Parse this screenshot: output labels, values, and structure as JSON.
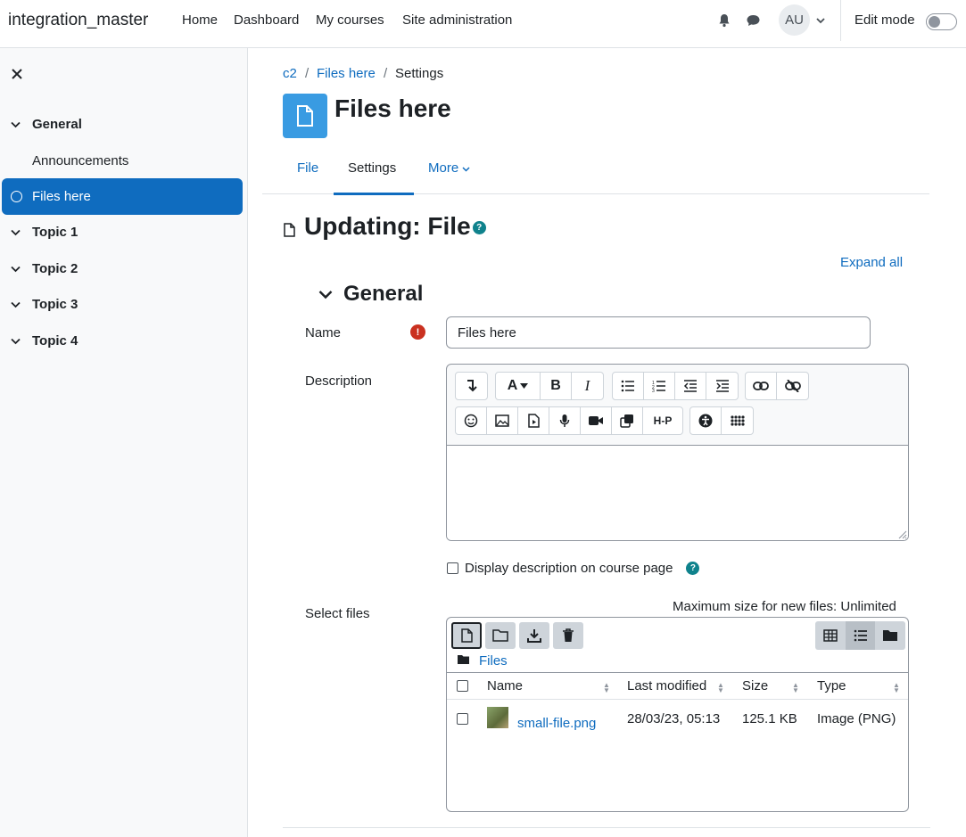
{
  "topbar": {
    "brand": "integration_master",
    "nav": [
      "Home",
      "Dashboard",
      "My courses",
      "Site administration"
    ],
    "avatar": "AU",
    "edit_mode": "Edit mode"
  },
  "drawer": {
    "sections": [
      {
        "label": "General",
        "activities": [
          "Announcements",
          "Files here"
        ]
      },
      {
        "label": "Topic 1"
      },
      {
        "label": "Topic 2"
      },
      {
        "label": "Topic 3"
      },
      {
        "label": "Topic 4"
      }
    ],
    "active": "Files here"
  },
  "breadcrumb": [
    "c2",
    "Files here",
    "Settings"
  ],
  "page_title": "Files here",
  "tabs": [
    "File",
    "Settings",
    "More"
  ],
  "active_tab": "Settings",
  "form": {
    "heading": "Updating: File",
    "expand_all": "Expand all",
    "section": "General",
    "name_label": "Name",
    "name_value": "Files here",
    "description_label": "Description",
    "display_desc_label": "Display description on course page",
    "select_files_label": "Select files",
    "max_size": "Maximum size for new files: Unlimited",
    "folder": "Files",
    "columns": [
      "Name",
      "Last modified",
      "Size",
      "Type"
    ],
    "files": [
      {
        "name": "small-file.png",
        "modified": "28/03/23, 05:13",
        "size": "125.1 KB",
        "type": "Image (PNG)"
      }
    ]
  },
  "colors": {
    "accent": "#0f6cbf",
    "required": "#ca3120",
    "help": "#0f828c",
    "module_icon": "#399be2"
  }
}
